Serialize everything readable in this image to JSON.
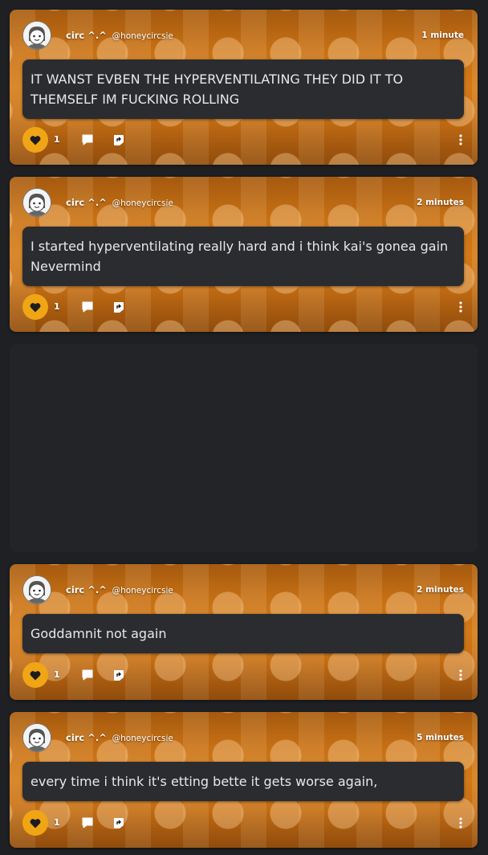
{
  "posts": [
    {
      "display_name": "circ ^.^",
      "username": "@honeycircsie",
      "time": "1 minute",
      "text": "IT WANST EVBEN THE HYPERVENTILATING THEY DID IT TO THEMSELF IM FUCKING ROLLING",
      "likes": "1"
    },
    {
      "display_name": "circ ^.^",
      "username": "@honeycircsie",
      "time": "2 minutes",
      "text": "I started hyperventilating really hard and i think kai's gonea gain Nevermind",
      "likes": "1"
    },
    {
      "display_name": "circ ^.^",
      "username": "@honeycircsie",
      "time": "2 minutes",
      "text": "Goddamnit not again",
      "likes": "1"
    },
    {
      "display_name": "circ ^.^",
      "username": "@honeycircsie",
      "time": "5 minutes",
      "text": "every time i think it's etting bette it gets worse again,",
      "likes": "1"
    }
  ],
  "icons": {
    "avatar": "avatar-icon",
    "like": "heart-icon",
    "comment": "comment-icon",
    "share": "share-icon",
    "more": "more-vertical-icon"
  },
  "colors": {
    "accent": "#f0a515",
    "card_background": "#c06a12",
    "bubble": "#2a2c30",
    "page_background": "#1e2023"
  }
}
